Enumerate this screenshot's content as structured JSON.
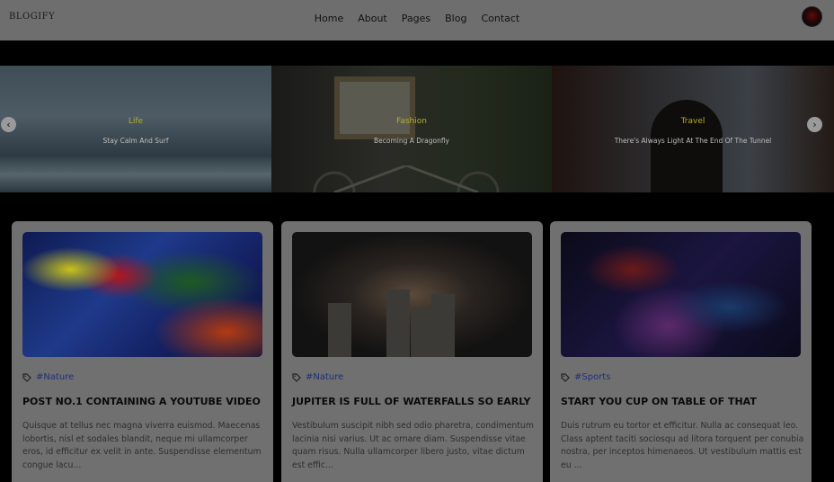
{
  "header": {
    "logo": "BLOGIFY",
    "nav": [
      "Home",
      "About",
      "Pages",
      "Blog",
      "Contact"
    ]
  },
  "slider": {
    "slides": [
      {
        "category": "Life",
        "subtitle": "Stay Calm And Surf"
      },
      {
        "category": "Fashion",
        "subtitle": "Becoming A Dragonfly"
      },
      {
        "category": "Travel",
        "subtitle": "There's Always Light At The End Of The Tunnel"
      }
    ],
    "prev_icon": "chevron-left-icon",
    "next_icon": "chevron-right-icon"
  },
  "posts": [
    {
      "tag": "#Nature",
      "title": "POST NO.1 CONTAINING A YOUTUBE VIDEO",
      "excerpt": "Quisque at tellus nec magna viverra euismod. Maecenas lobortis, nisl et sodales blandit, neque mi ullamcorper eros, id efficitur ex velit in ante. Suspendisse elementum congue lacu..."
    },
    {
      "tag": "#Nature",
      "title": "JUPITER IS FULL OF WATERFALLS SO EARLY",
      "excerpt": "Vestibulum suscipit nibh sed odio pharetra, condimentum lacinia nisi varius. Ut ac ornare diam. Suspendisse vitae quam risus. Nulla ullamcorper libero justo, vitae dictum est effic..."
    },
    {
      "tag": "#Sports",
      "title": "START YOU CUP ON TABLE OF THAT",
      "excerpt": "Duis rutrum eu tortor et efficitur. Nulla ac consequat leo. Class aptent taciti sociosqu ad litora torquent per conubia nostra, per inceptos himenaeos. Ut vestibulum mattis est eu ..."
    }
  ],
  "colors": {
    "tag_text": "#1f2f7a",
    "slide_category": "#b5ad2a",
    "overlay": "#000000"
  }
}
